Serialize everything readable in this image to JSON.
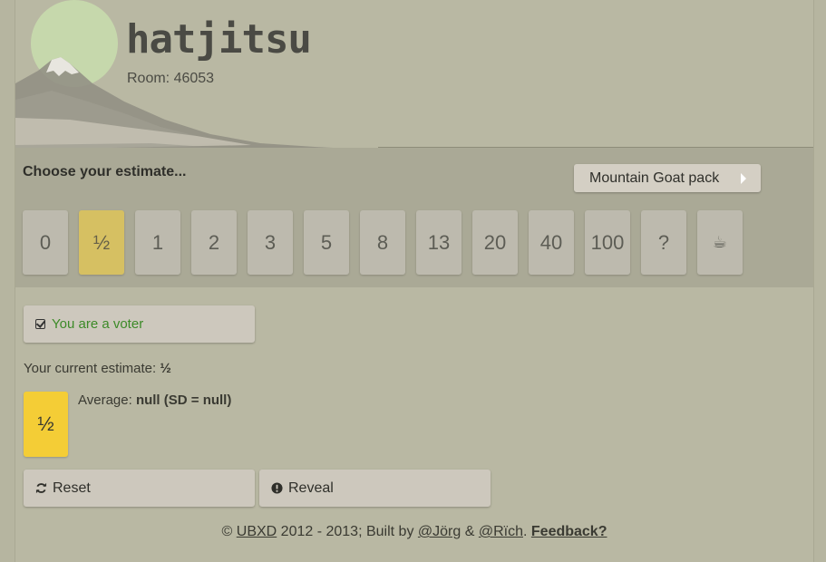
{
  "header": {
    "logo": "hatjitsu",
    "room_label": "Room: 46053"
  },
  "estimate": {
    "title": "Choose your estimate...",
    "pack_button": "Mountain Goat pack",
    "cards": [
      "0",
      "½",
      "1",
      "2",
      "3",
      "5",
      "8",
      "13",
      "20",
      "40",
      "100",
      "?",
      "☕"
    ],
    "selected_index": 1
  },
  "status": {
    "voter_label": "You are a voter",
    "current_estimate_prefix": "Your current estimate:",
    "current_estimate_value": "½",
    "vote_card_value": "½",
    "average_prefix": "Average:",
    "average_value": "null (SD = null)"
  },
  "actions": {
    "reset_label": "Reset",
    "reveal_label": "Reveal"
  },
  "footer": {
    "copyright": "©",
    "ubxd_link": "UBXD",
    "years_built": "2012 - 2013; Built by",
    "jorg_link": "@Jörg",
    "amp": "&",
    "rich_link": "@Rïch",
    "period": ".",
    "feedback_link": "Feedback?"
  },
  "colors": {
    "page_bg": "#b9b8a3",
    "band_bg": "#aaa996",
    "selected_card": "#d6c062",
    "vote_card": "#f4cd36",
    "sun": "#c6d8ac",
    "voter_text": "#3c8a28"
  },
  "icons": {
    "voter": "check-square-icon",
    "reset": "refresh-icon",
    "reveal": "exclamation-circle-icon",
    "pack": "caret-right-icon"
  }
}
